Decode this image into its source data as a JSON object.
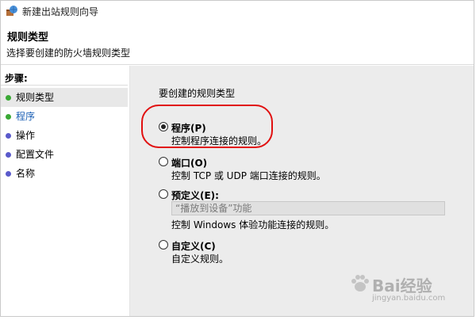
{
  "window": {
    "title": "新建出站规则向导"
  },
  "header": {
    "title": "规则类型",
    "subtitle": "选择要创建的防火墙规则类型"
  },
  "sidebar": {
    "steps_label": "步骤:",
    "items": [
      {
        "label": "规则类型",
        "bullet_color": "#3aa935"
      },
      {
        "label": "程序",
        "bullet_color": "#3aa935"
      },
      {
        "label": "操作",
        "bullet_color": "#5a5acb"
      },
      {
        "label": "配置文件",
        "bullet_color": "#5a5acb"
      },
      {
        "label": "名称",
        "bullet_color": "#5a5acb"
      }
    ]
  },
  "main": {
    "question": "要创建的规则类型",
    "options": [
      {
        "label": "程序(P)",
        "description": "控制程序连接的规则。",
        "selected": true
      },
      {
        "label": "端口(O)",
        "description": "控制 TCP 或 UDP 端口连接的规则。",
        "selected": false
      },
      {
        "label": "预定义(E):",
        "description": "控制 Windows 体验功能连接的规则。",
        "selected": false
      },
      {
        "label": "自定义(C)",
        "description": "自定义规则。",
        "selected": false
      }
    ],
    "predefined_select_value": "“播放到设备”功能"
  },
  "watermark": {
    "main": "Bai经验",
    "sub": "jingyan.baidu.com"
  },
  "colors": {
    "highlight": "#e11010",
    "active_step": "#1a5fb4"
  }
}
